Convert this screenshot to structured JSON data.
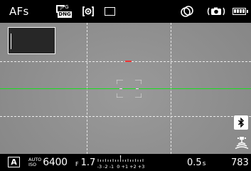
{
  "top_bar": {
    "af_mode": "AFs",
    "file_format": {
      "icon": "jpg-dng-icon",
      "line1": "JPG",
      "line2": "DNG"
    },
    "metering_icon": "spot-metering-icon",
    "drive_icon": "single-drive-icon",
    "white_balance_icon": "auto-white-balance-icon",
    "stabilization_icon": "stabilization-icon",
    "battery_icon": "battery-full-icon"
  },
  "viewfinder": {
    "grid": "3x4 dashed",
    "horizon_color": "#18e01f",
    "horizon_tick_color": "#ee3333",
    "af_frame_color": "#e8e8e8"
  },
  "side_icons": {
    "bluetooth_icon": "bluetooth-icon",
    "gps_icon": "gps-signal-icon"
  },
  "bottom_bar": {
    "exposure_mode": "A",
    "iso_auto": "AUTO",
    "iso_label": "ISO",
    "iso_value": "6400",
    "aperture_f": "F",
    "aperture_value": "1.7",
    "ev_scale_labels": "-3 -2 -1  0 +1 +2 +3",
    "shutter_speed": "0.5",
    "shutter_unit": "s",
    "shots_remaining": "783"
  }
}
